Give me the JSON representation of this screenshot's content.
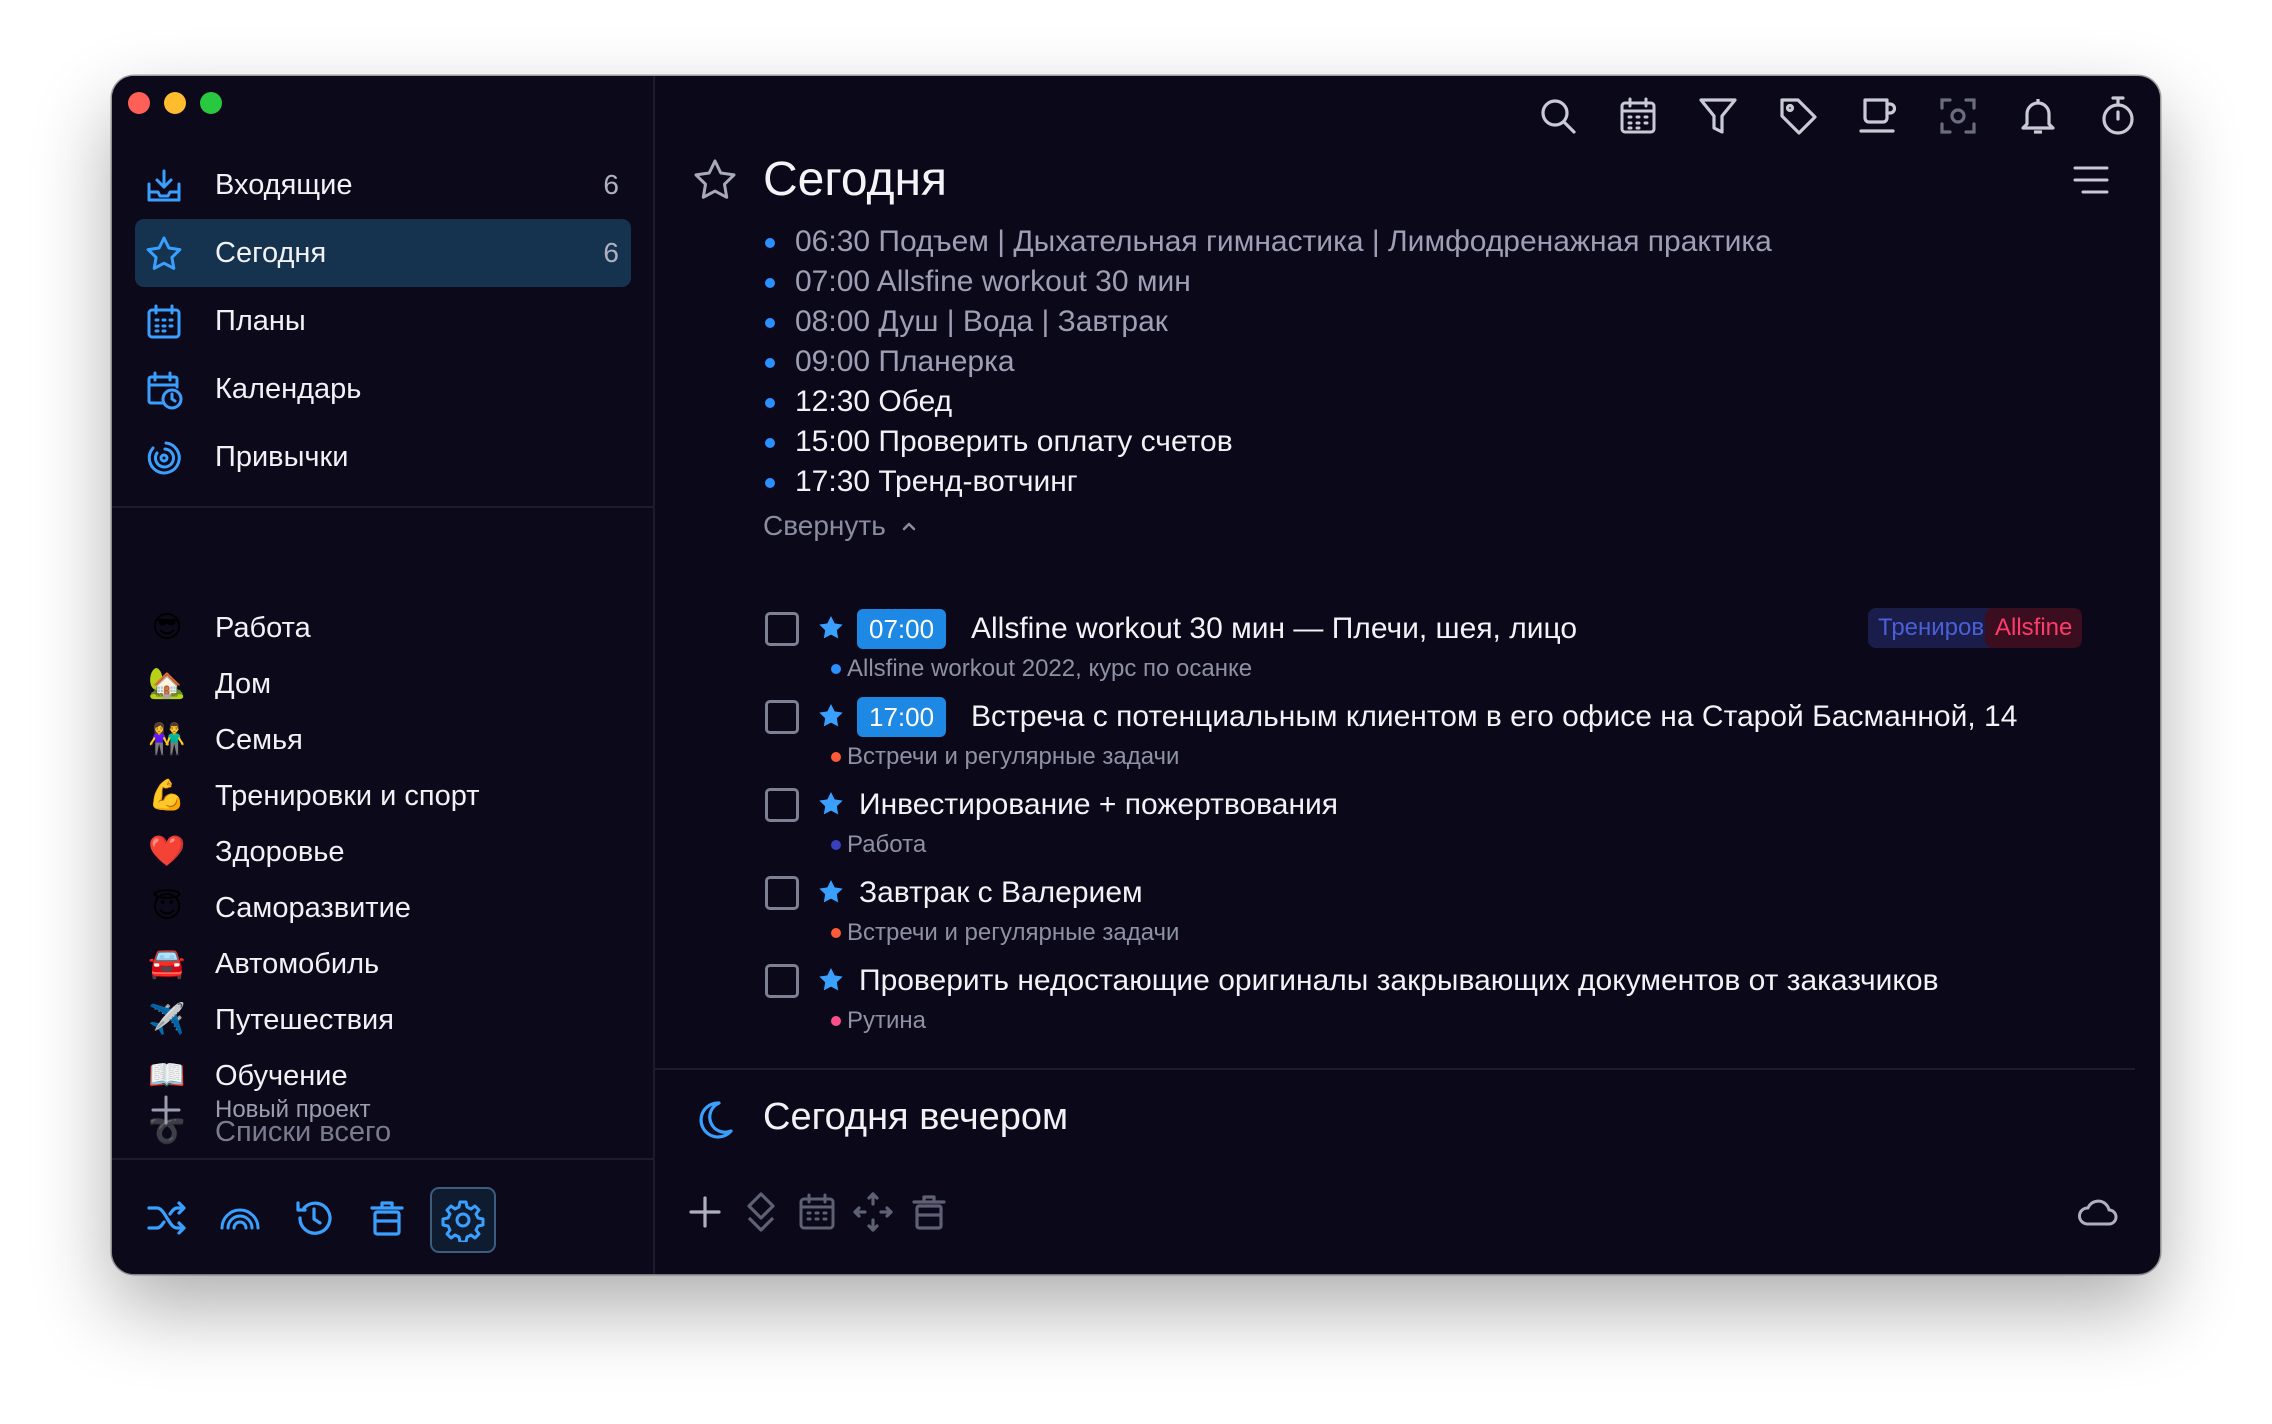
{
  "sidebar": {
    "nav": [
      {
        "label": "Входящие",
        "count": "6",
        "icon": "inbox-icon"
      },
      {
        "label": "Сегодня",
        "count": "6",
        "icon": "star-icon"
      },
      {
        "label": "Планы",
        "count": "",
        "icon": "plans-calendar-icon"
      },
      {
        "label": "Календарь",
        "count": "",
        "icon": "calendar-clock-icon"
      },
      {
        "label": "Привычки",
        "count": "",
        "icon": "habits-icon"
      }
    ],
    "projects": [
      {
        "emoji": "😎",
        "label": "Работа"
      },
      {
        "emoji": "🏡",
        "label": "Дом"
      },
      {
        "emoji": "👫",
        "label": "Семья"
      },
      {
        "emoji": "💪",
        "label": "Тренировки и спорт"
      },
      {
        "emoji": "❤️",
        "label": "Здоровье"
      },
      {
        "emoji": "😇",
        "label": "Саморазвитие"
      },
      {
        "emoji": "🚘",
        "label": "Автомобиль"
      },
      {
        "emoji": "✈️",
        "label": "Путешествия"
      },
      {
        "emoji": "📖",
        "label": "Обучение"
      },
      {
        "emoji": "➰",
        "label": "Списки всего"
      }
    ],
    "new_project": "Новый проект"
  },
  "main": {
    "title": "Сегодня",
    "notes": [
      {
        "text": "06:30 Подъем | Дыхательная гимнастика | Лимфодренажная практика",
        "style": "dim"
      },
      {
        "text": "07:00 Allsfine workout 30 мин",
        "style": "dim"
      },
      {
        "text": "08:00 Душ | Вода | Завтрак",
        "style": "dim"
      },
      {
        "text": "09:00 Планерка",
        "style": "dim"
      },
      {
        "text": "12:30 Обед",
        "style": "bright"
      },
      {
        "text": "15:00 Проверить оплату счетов",
        "style": "bright"
      },
      {
        "text": "17:30 Тренд-вотчинг",
        "style": "bright"
      }
    ],
    "collapse_label": "Свернуть",
    "tasks": [
      {
        "time": "07:00",
        "title": "Allsfine workout 30 мин — Плечи, шея, лицо",
        "project": "Allsfine workout 2022, курс по осанке",
        "dot": "#2b8fff",
        "tags": [
          {
            "label": "Тренировки",
            "fg": "#4a5fd6",
            "bg": "#1a1d4a"
          },
          {
            "label": "Allsfine",
            "fg": "#ff3b6b",
            "bg": "#3a0d1f"
          }
        ]
      },
      {
        "time": "17:00",
        "title": "Встреча с потенциальным клиентом в его офисе на Старой Басманной, 14",
        "project": "Встречи и регулярные задачи",
        "dot": "#ff5a36",
        "tags": []
      },
      {
        "time": "",
        "title": "Инвестирование + пожертвования",
        "project": "Работа",
        "dot": "#3a3fbd",
        "tags": []
      },
      {
        "time": "",
        "title": "Завтрак с Валерием",
        "project": "Встречи и регулярные задачи",
        "dot": "#ff5a36",
        "tags": []
      },
      {
        "time": "",
        "title": "Проверить недостающие оригиналы закрывающих документов от заказчиков",
        "project": "Рутина",
        "dot": "#ff4f8b",
        "tags": []
      }
    ],
    "evening_title": "Сегодня вечером"
  },
  "colors": {
    "accent": "#2b8fff",
    "window_bg": "#0b0819",
    "active_nav": "#15324f"
  }
}
